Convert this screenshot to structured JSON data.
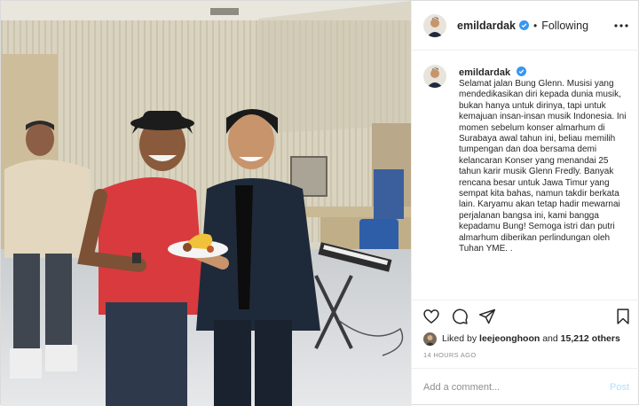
{
  "header": {
    "username": "emildardak",
    "separator": "•",
    "follow_status": "Following",
    "verified_icon": "verified-badge-icon",
    "more_icon": "more-options-icon"
  },
  "caption": {
    "username": "emildardak",
    "text": "Selamat jalan Bung Glenn. Musisi yang mendedikasikan diri kepada dunia musik, bukan hanya untuk dirinya, tapi untuk kemajuan insan-insan musik Indonesia. Ini momen sebelum konser almarhum di Surabaya awal tahun ini, beliau memilih tumpengan dan doa bersama demi kelancaran Konser yang menandai 25 tahun karir musik Glenn Fredly. Banyak rencana besar untuk Jawa Timur yang sempat kita bahas, namun takdir berkata lain. Karyamu akan tetap hadir mewarnai perjalanan bangsa ini, kami bangga kepadamu Bung! Semoga istri dan putri almarhum diberikan perlindungan oleh Tuhan YME. ."
  },
  "actions": {
    "like_icon": "heart-icon",
    "comment_icon": "comment-bubble-icon",
    "share_icon": "paper-plane-icon",
    "save_icon": "bookmark-icon"
  },
  "likes": {
    "prefix": "Liked by",
    "user": "leejeonghoon",
    "connector": "and",
    "count": "15,212 others"
  },
  "timestamp": "14 HOURS AGO",
  "comment_box": {
    "placeholder": "Add a comment...",
    "post_label": "Post"
  },
  "colors": {
    "verified_blue": "#3897f0",
    "post_disabled": "#b2dffc",
    "border": "#efefef",
    "text": "#262626",
    "muted": "#8e8e8e"
  }
}
